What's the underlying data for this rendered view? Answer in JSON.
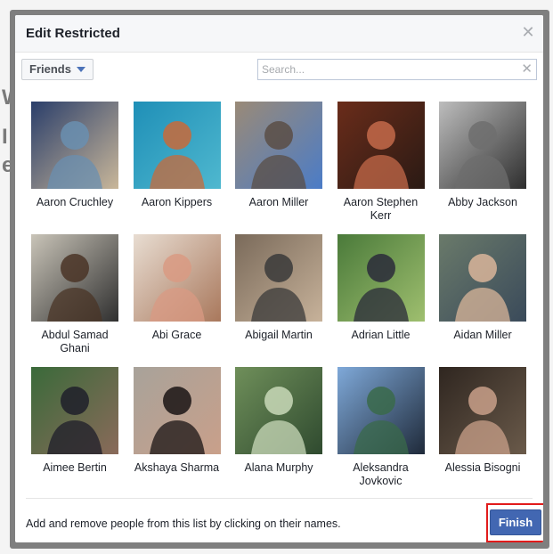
{
  "background": {
    "glyphs": [
      "W",
      "I",
      "e"
    ]
  },
  "dialog": {
    "title": "Edit Restricted",
    "close_icon": "close-icon"
  },
  "toolbar": {
    "filter_label": "Friends",
    "search_placeholder": "Search...",
    "search_value": ""
  },
  "people": [
    {
      "name": "Aaron Cruchley",
      "colors": [
        "#2a3e6a",
        "#6a8fb0",
        "#c9b79a"
      ]
    },
    {
      "name": "Aaron Kippers",
      "colors": [
        "#1f8fb7",
        "#c86a3a",
        "#4fb8cf"
      ]
    },
    {
      "name": "Aaron Miller",
      "colors": [
        "#9a8a77",
        "#5a4e45",
        "#4b7cc7"
      ]
    },
    {
      "name": "Aaron Stephen Kerr",
      "colors": [
        "#6a2c1a",
        "#c46a4a",
        "#2a1a14"
      ]
    },
    {
      "name": "Abby Jackson",
      "colors": [
        "#bdbdbd",
        "#6e6e6e",
        "#2e2e2e"
      ]
    },
    {
      "name": "Abdul Samad Ghani",
      "colors": [
        "#c9c4b8",
        "#4a3426",
        "#2f2f2f"
      ]
    },
    {
      "name": "Abi Grace",
      "colors": [
        "#e8ddd2",
        "#d99a83",
        "#a9785c"
      ]
    },
    {
      "name": "Abigail Martin",
      "colors": [
        "#7a6a5a",
        "#3a3a3a",
        "#c7b29a"
      ]
    },
    {
      "name": "Adrian Little",
      "colors": [
        "#4a7a3a",
        "#2a2a3a",
        "#9fbf6f"
      ]
    },
    {
      "name": "Aidan Miller",
      "colors": [
        "#6a7a6a",
        "#d9b59a",
        "#3a4a5a"
      ]
    },
    {
      "name": "Aimee Bertin",
      "colors": [
        "#3a6a3a",
        "#1e1e2a",
        "#8a6a5a"
      ]
    },
    {
      "name": "Akshaya Sharma",
      "colors": [
        "#a8a29a",
        "#1a1414",
        "#c9a08a"
      ]
    },
    {
      "name": "Alana Murphy",
      "colors": [
        "#6f8f5a",
        "#c9d9b9",
        "#2f4a2f"
      ]
    },
    {
      "name": "Aleksandra Jovkovic",
      "colors": [
        "#7fa9d9",
        "#3a6a4a",
        "#1f2a3a"
      ]
    },
    {
      "name": "Alessia Bisogni",
      "colors": [
        "#2f2620",
        "#c9a08a",
        "#6a5a4a"
      ]
    }
  ],
  "footer": {
    "hint": "Add and remove people from this list by clicking on their names.",
    "finish_label": "Finish"
  },
  "colors": {
    "accent": "#4267b2",
    "highlight": "#e11b1b"
  }
}
